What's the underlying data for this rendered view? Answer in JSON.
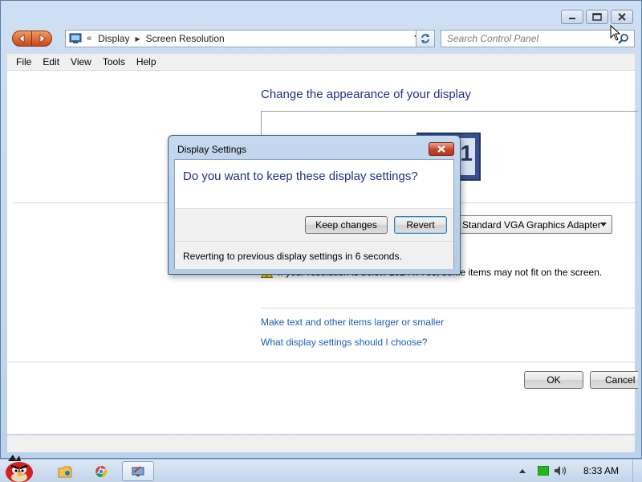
{
  "window": {
    "address": {
      "overflow": "«",
      "crumbs": [
        "Display",
        "Screen Resolution"
      ]
    },
    "search_placeholder": "Search Control Panel",
    "menu": [
      "File",
      "Edit",
      "View",
      "Tools",
      "Help"
    ]
  },
  "content": {
    "heading": "Change the appearance of your display",
    "monitor_digit": "1",
    "adapter_select": "Standard VGA Graphics Adapter",
    "warning_text": "If your resolution is below 1024 x 768, some items may not fit on the screen.",
    "links": [
      "Make text and other items larger or smaller",
      "What display settings should I choose?"
    ],
    "ok_label": "OK",
    "cancel_label": "Cancel"
  },
  "dialog": {
    "title": "Display Settings",
    "question": "Do you want to keep these display settings?",
    "keep_label": "Keep changes",
    "revert_label": "Revert",
    "status": "Reverting to previous display settings in 6 seconds."
  },
  "taskbar": {
    "clock": "8:33 AM",
    "pinned": [
      "angry-birds-start-icon",
      "folder-icon",
      "chrome-icon",
      "display-settings-icon"
    ]
  },
  "colors": {
    "heading": "#1e3287",
    "link": "#1a5fb4",
    "close_red": "#c7452e"
  }
}
